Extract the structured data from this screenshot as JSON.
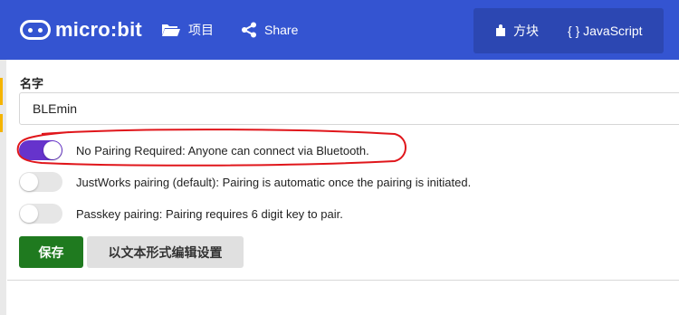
{
  "header": {
    "logo_text": "micro:bit",
    "projects_label": "项目",
    "share_label": "Share",
    "blocks_label": "方块",
    "javascript_label": "{ } JavaScript"
  },
  "settings": {
    "name_label": "名字",
    "name_value": "BLEmin",
    "options": [
      {
        "label": "No Pairing Required: Anyone can connect via Bluetooth.",
        "selected": true
      },
      {
        "label": "JustWorks pairing (default): Pairing is automatic once the pairing is initiated.",
        "selected": false
      },
      {
        "label": "Passkey pairing: Pairing requires 6 digit key to pair.",
        "selected": false
      }
    ],
    "save_label": "保存",
    "edit_as_text_label": "以文本形式编辑设置"
  },
  "colors": {
    "header_bg": "#3454d1",
    "toggle_on": "#6633cc",
    "save_bg": "#1f7a1f",
    "annotation": "#e0161b"
  }
}
